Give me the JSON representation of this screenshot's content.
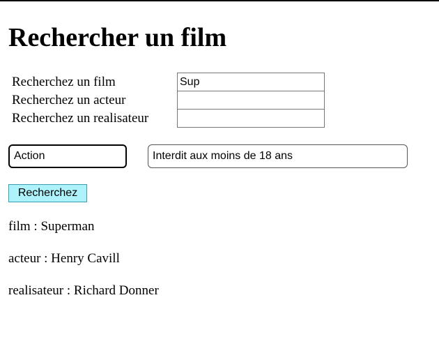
{
  "page": {
    "title": "Rechercher un film"
  },
  "search": {
    "film_label": "Recherchez un film",
    "film_value": "Sup",
    "acteur_label": "Recherchez un acteur",
    "acteur_value": "",
    "realisateur_label": "Recherchez un realisateur",
    "realisateur_value": ""
  },
  "filters": {
    "genre_selected": "Action",
    "rating_selected": "Interdit aux moins de 18 ans"
  },
  "actions": {
    "submit_label": "Recherchez"
  },
  "results": {
    "film": "film : Superman",
    "acteur": "acteur : Henry Cavill",
    "realisateur": "realisateur : Richard Donner"
  },
  "colors": {
    "button_bg": "#aef3fb",
    "button_border": "#3a9db0"
  }
}
